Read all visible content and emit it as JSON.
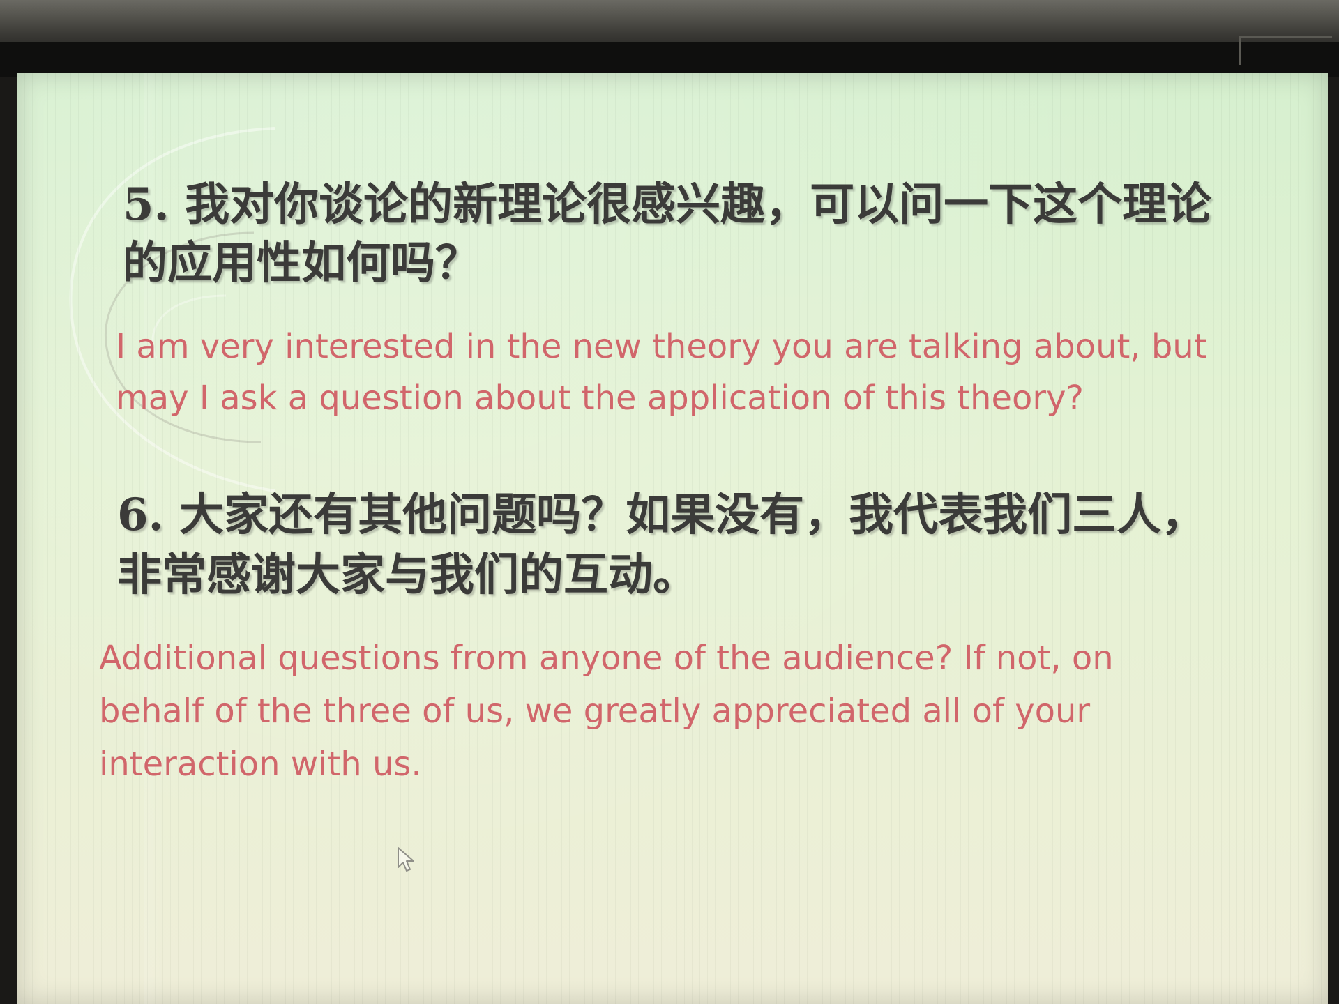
{
  "slide": {
    "q5_text": "5. 我对你谈论的新理论很感兴趣，可以问一下这个理论的应用性如何吗？",
    "q5_translation": "I am very interested in the new theory you are talking about, but may I ask a question about the application of this theory?",
    "q6_text": "6. 大家还有其他问题吗？如果没有，我代表我们三人，非常感谢大家与我们的互动。",
    "q6_translation": "Additional questions from anyone of the audience? If not, on behalf of the three of us, we greatly appreciated all of your interaction with us."
  },
  "colors": {
    "background": "#e4f2d4",
    "question_text": "#3b3b39",
    "translation_text": "#d1666b"
  },
  "icons": {
    "pointer": "mouse-cursor-icon"
  }
}
